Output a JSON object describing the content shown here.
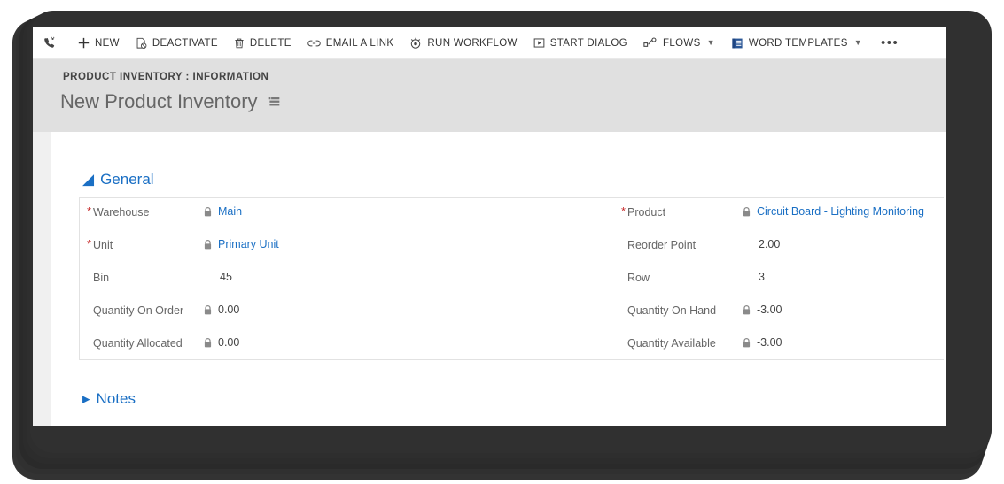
{
  "commandbar": {
    "phone_icon": "phone-call-icon",
    "items": [
      {
        "label": "NEW",
        "icon": "plus-icon",
        "caret": false
      },
      {
        "label": "DEACTIVATE",
        "icon": "deactivate-icon",
        "caret": false
      },
      {
        "label": "DELETE",
        "icon": "trash-icon",
        "caret": false
      },
      {
        "label": "EMAIL A LINK",
        "icon": "link-icon",
        "caret": false
      },
      {
        "label": "RUN WORKFLOW",
        "icon": "workflow-icon",
        "caret": false
      },
      {
        "label": "START DIALOG",
        "icon": "play-box-icon",
        "caret": false
      },
      {
        "label": "FLOWS",
        "icon": "flows-icon",
        "caret": true
      },
      {
        "label": "WORD TEMPLATES",
        "icon": "word-doc-icon",
        "caret": true
      }
    ],
    "overflow_label": "•••"
  },
  "header": {
    "breadcrumb": "PRODUCT INVENTORY : INFORMATION",
    "title": "New Product Inventory",
    "form_selector_icon": "form-selector-icon"
  },
  "sections": {
    "general": {
      "label": "General",
      "expanded": true,
      "triangle": "◢"
    },
    "notes": {
      "label": "Notes",
      "expanded": false,
      "triangle": "▸"
    }
  },
  "fields": {
    "left": [
      {
        "label": "Warehouse",
        "value": "Main",
        "required": true,
        "locked": true,
        "link": true
      },
      {
        "label": "Unit",
        "value": "Primary Unit",
        "required": true,
        "locked": true,
        "link": true
      },
      {
        "label": "Bin",
        "value": "45",
        "required": false,
        "locked": false,
        "link": false
      },
      {
        "label": "Quantity On Order",
        "value": "0.00",
        "required": false,
        "locked": true,
        "link": false
      },
      {
        "label": "Quantity Allocated",
        "value": "0.00",
        "required": false,
        "locked": true,
        "link": false
      }
    ],
    "right": [
      {
        "label": "Product",
        "value": "Circuit Board - Lighting Monitoring",
        "required": true,
        "locked": true,
        "link": true
      },
      {
        "label": "Reorder Point",
        "value": "2.00",
        "required": false,
        "locked": false,
        "link": false
      },
      {
        "label": "Row",
        "value": "3",
        "required": false,
        "locked": false,
        "link": false
      },
      {
        "label": "Quantity On Hand",
        "value": "-3.00",
        "required": false,
        "locked": true,
        "link": false
      },
      {
        "label": "Quantity Available",
        "value": "-3.00",
        "required": false,
        "locked": true,
        "link": false
      }
    ]
  },
  "colors": {
    "link": "#1a6fc4",
    "required": "#c62828",
    "header_band": "#e0e0e0",
    "label": "#666666",
    "bezel": "#2b2b2b"
  }
}
